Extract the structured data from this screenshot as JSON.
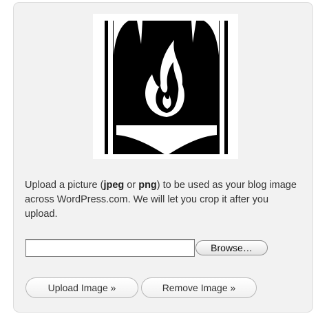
{
  "blog_image": {
    "logo": {
      "icon": "torch-flame-logo"
    },
    "description": {
      "part1": "Upload a picture (",
      "format1": "jpeg",
      "part2": " or ",
      "format2": "png",
      "part3": ") to be used as your blog image across WordPress.com. We will let you crop it after you upload."
    },
    "file_input": {
      "value": "",
      "browse_label": "Browse…"
    },
    "buttons": {
      "upload_label": "Upload Image »",
      "remove_label": "Remove Image »"
    }
  }
}
